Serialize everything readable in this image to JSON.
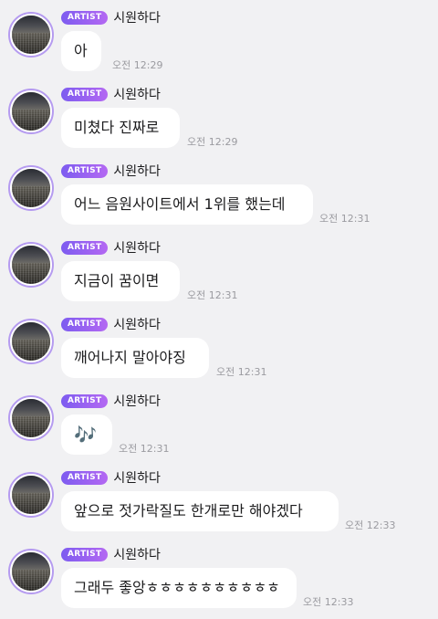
{
  "chat": {
    "messages": [
      {
        "badge": "ARTIST",
        "sender": "시원하다",
        "text": "아",
        "time": "오전 12:29"
      },
      {
        "badge": "ARTIST",
        "sender": "시원하다",
        "text": "미쳤다 진짜로",
        "time": "오전 12:29"
      },
      {
        "badge": "ARTIST",
        "sender": "시원하다",
        "text": "어느 음원사이트에서 1위를 했는데",
        "time": "오전 12:31"
      },
      {
        "badge": "ARTIST",
        "sender": "시원하다",
        "text": "지금이 꿈이면",
        "time": "오전 12:31"
      },
      {
        "badge": "ARTIST",
        "sender": "시원하다",
        "text": "깨어나지 말아야징",
        "time": "오전 12:31"
      },
      {
        "badge": "ARTIST",
        "sender": "시원하다",
        "text": "🎶",
        "time": "오전 12:31"
      },
      {
        "badge": "ARTIST",
        "sender": "시원하다",
        "text": "앞으로 젓가락질도 한개로만 해야겠다",
        "time": "오전 12:33"
      },
      {
        "badge": "ARTIST",
        "sender": "시원하다",
        "text": "그래두 좋앙ㅎㅎㅎㅎㅎㅎㅎㅎㅎㅎ",
        "time": "오전 12:33"
      }
    ]
  }
}
